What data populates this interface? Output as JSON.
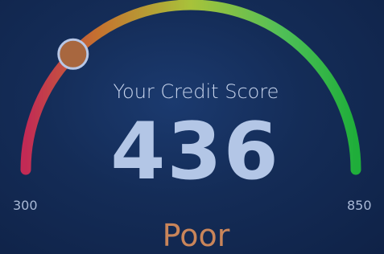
{
  "gauge": {
    "title": "Your Credit Score",
    "score": "436",
    "min_label": "300",
    "max_label": "850",
    "rating": "Poor",
    "score_value": 436,
    "min_value": 300,
    "max_value": 850
  },
  "colors": {
    "arc_start": "#c22a55",
    "arc_mid_orange": "#c5722f",
    "arc_mid_yellow": "#a8c23a",
    "arc_end": "#1fae3a",
    "rating": "#c9855a",
    "score": "#b3c6e6",
    "marker_fill": "#a8673f",
    "marker_ring": "#b8c7e6"
  },
  "icons": {
    "marker": "score-indicator-dot"
  }
}
